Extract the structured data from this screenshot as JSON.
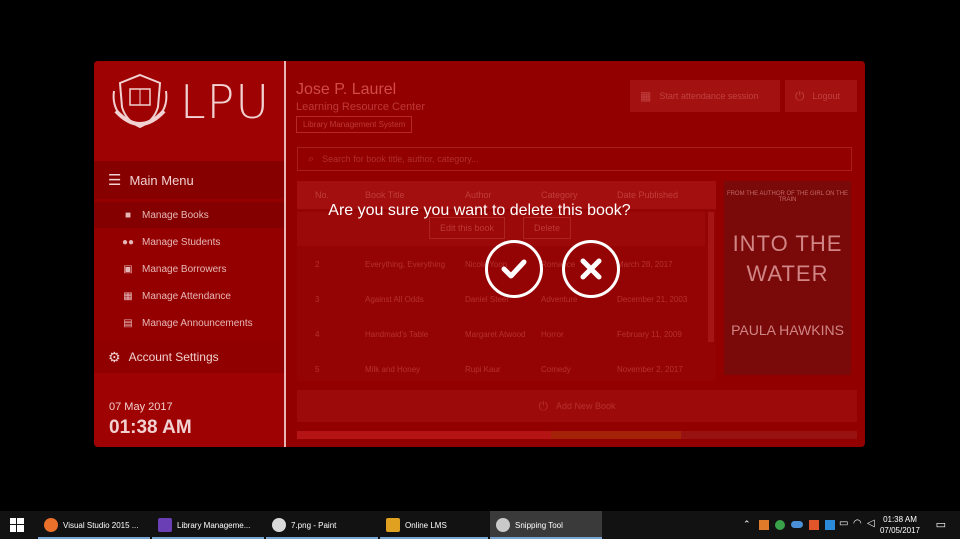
{
  "sidebar": {
    "logo_text": "LPU",
    "main_menu_label": "Main Menu",
    "items": [
      {
        "label": "Manage Books",
        "icon": "book-icon"
      },
      {
        "label": "Manage Students",
        "icon": "users-icon"
      },
      {
        "label": "Manage Borrowers",
        "icon": "borrower-icon"
      },
      {
        "label": "Manage Attendance",
        "icon": "calendar-icon"
      },
      {
        "label": "Manage Announcements",
        "icon": "announcement-icon"
      }
    ],
    "account_label": "Account Settings",
    "date": "07 May 2017",
    "time": "01:38 AM"
  },
  "header": {
    "school_name": "Jose P. Laurel",
    "subtitle": "Learning Resource Center",
    "system_badge": "Library Management System",
    "attendance_button": "Start attendance session",
    "logout_button": "Logout"
  },
  "search": {
    "placeholder": "Search for book title, author, category..."
  },
  "table": {
    "columns": [
      "No.",
      "Book Title",
      "Author",
      "Category",
      "Date Published"
    ],
    "selected_row_actions": {
      "edit": "Edit this book",
      "delete": "Delete"
    },
    "rows": [
      {
        "no": "2",
        "title": "Everything, Everything",
        "author": "Nicola Yoon",
        "category": "Romance",
        "date": "March 28, 2017"
      },
      {
        "no": "3",
        "title": "Against All Odds",
        "author": "Daniel Steel",
        "category": "Adventure",
        "date": "December 21, 2003"
      },
      {
        "no": "4",
        "title": "Handmaid's Table",
        "author": "Margaret Atwood",
        "category": "Horror",
        "date": "February 11, 2009"
      },
      {
        "no": "5",
        "title": "Milk and Honey",
        "author": "Rupi Kaur",
        "category": "Comedy",
        "date": "November 2, 2017"
      }
    ]
  },
  "cover": {
    "tagline": "FROM THE AUTHOR OF THE GIRL ON THE TRAIN",
    "title": "INTO THE WATER",
    "author": "PAULA HAWKINS"
  },
  "add_button": "Add New Book",
  "dialog": {
    "message": "Are you sure you want to delete this book?",
    "confirm_icon": "check-icon",
    "cancel_icon": "close-icon"
  },
  "taskbar": {
    "items": [
      {
        "label": "Visual Studio 2015 ..."
      },
      {
        "label": "Library Manageme..."
      },
      {
        "label": "7.png - Paint"
      },
      {
        "label": "Online LMS"
      },
      {
        "label": "Snipping Tool"
      }
    ],
    "clock_time": "01:38 AM",
    "clock_date": "07/05/2017"
  },
  "colors": {
    "primary": "#8e0000",
    "accent": "#a01212",
    "dialog_text": "#ffffff"
  }
}
